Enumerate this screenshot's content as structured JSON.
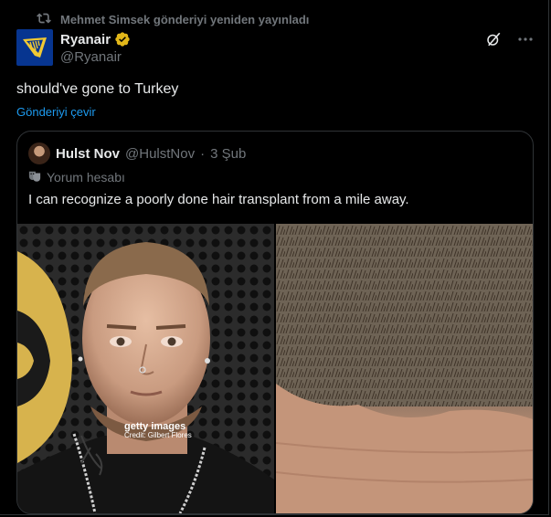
{
  "repost": {
    "text": "Mehmet Simsek gönderiyi yeniden yayınladı",
    "icon": "repost-icon"
  },
  "author": {
    "name": "Ryanair",
    "handle": "@Ryanair",
    "avatar_color": "#073590",
    "brand_gold": "#f1c933",
    "verified_color": "#e2b719"
  },
  "tweet": {
    "text": "should've gone to Turkey",
    "translate_label": "Gönderiyi çevir"
  },
  "quote": {
    "name": "Hulst Nov",
    "handle": "@HulstNov",
    "separator": "·",
    "date": "3 Şub",
    "label": "Yorum hesabı",
    "text": "I can recognize a poorly done hair transplant from a mile away."
  },
  "media": {
    "watermark_brand": "getty images",
    "watermark_credit": "Credit: Gilbert Flores"
  },
  "colors": {
    "background": "#000000",
    "text": "#e7e9ea",
    "muted": "#71767b",
    "link": "#1d9bf0",
    "border": "#2f3336"
  }
}
